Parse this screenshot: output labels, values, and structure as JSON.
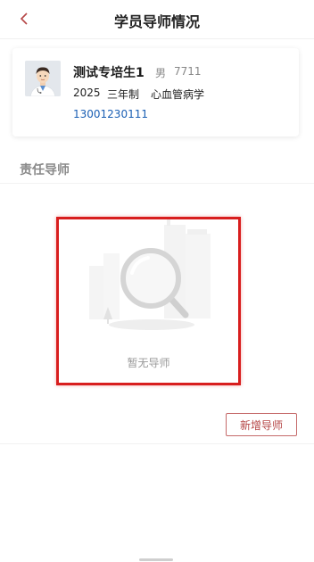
{
  "header": {
    "title": "学员导师情况"
  },
  "student": {
    "name": "测试专培生1",
    "gender": "男",
    "id": "7711",
    "year": "2025",
    "program": "三年制",
    "department": "心血管病学",
    "phone": "13001230111"
  },
  "section": {
    "title": "责任导师"
  },
  "empty_state": {
    "text": "暂无导师"
  },
  "actions": {
    "add_mentor_label": "新增导师"
  },
  "colors": {
    "accent": "#b54545",
    "highlight_border": "#d81e1e",
    "link": "#1a5fb4"
  }
}
